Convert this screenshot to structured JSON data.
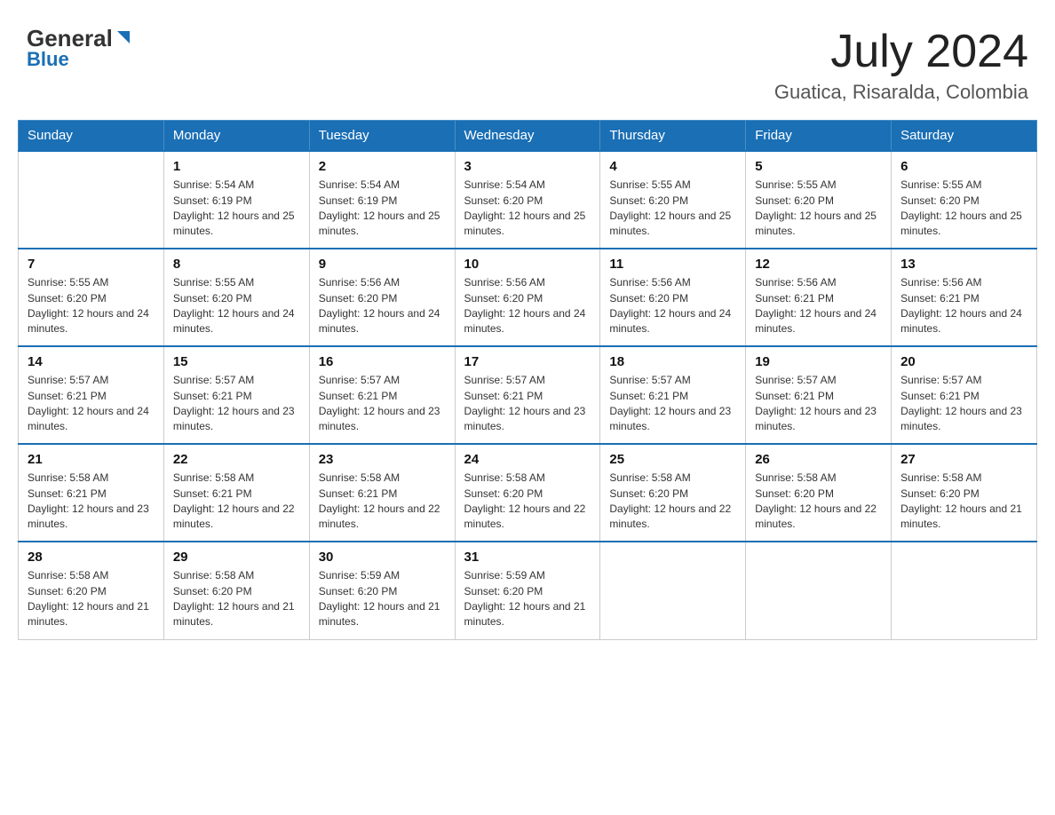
{
  "header": {
    "logo_general": "General",
    "logo_blue": "Blue",
    "month_title": "July 2024",
    "location": "Guatica, Risaralda, Colombia"
  },
  "weekdays": [
    "Sunday",
    "Monday",
    "Tuesday",
    "Wednesday",
    "Thursday",
    "Friday",
    "Saturday"
  ],
  "weeks": [
    [
      {
        "day": "",
        "sunrise": "",
        "sunset": "",
        "daylight": ""
      },
      {
        "day": "1",
        "sunrise": "Sunrise: 5:54 AM",
        "sunset": "Sunset: 6:19 PM",
        "daylight": "Daylight: 12 hours and 25 minutes."
      },
      {
        "day": "2",
        "sunrise": "Sunrise: 5:54 AM",
        "sunset": "Sunset: 6:19 PM",
        "daylight": "Daylight: 12 hours and 25 minutes."
      },
      {
        "day": "3",
        "sunrise": "Sunrise: 5:54 AM",
        "sunset": "Sunset: 6:20 PM",
        "daylight": "Daylight: 12 hours and 25 minutes."
      },
      {
        "day": "4",
        "sunrise": "Sunrise: 5:55 AM",
        "sunset": "Sunset: 6:20 PM",
        "daylight": "Daylight: 12 hours and 25 minutes."
      },
      {
        "day": "5",
        "sunrise": "Sunrise: 5:55 AM",
        "sunset": "Sunset: 6:20 PM",
        "daylight": "Daylight: 12 hours and 25 minutes."
      },
      {
        "day": "6",
        "sunrise": "Sunrise: 5:55 AM",
        "sunset": "Sunset: 6:20 PM",
        "daylight": "Daylight: 12 hours and 25 minutes."
      }
    ],
    [
      {
        "day": "7",
        "sunrise": "Sunrise: 5:55 AM",
        "sunset": "Sunset: 6:20 PM",
        "daylight": "Daylight: 12 hours and 24 minutes."
      },
      {
        "day": "8",
        "sunrise": "Sunrise: 5:55 AM",
        "sunset": "Sunset: 6:20 PM",
        "daylight": "Daylight: 12 hours and 24 minutes."
      },
      {
        "day": "9",
        "sunrise": "Sunrise: 5:56 AM",
        "sunset": "Sunset: 6:20 PM",
        "daylight": "Daylight: 12 hours and 24 minutes."
      },
      {
        "day": "10",
        "sunrise": "Sunrise: 5:56 AM",
        "sunset": "Sunset: 6:20 PM",
        "daylight": "Daylight: 12 hours and 24 minutes."
      },
      {
        "day": "11",
        "sunrise": "Sunrise: 5:56 AM",
        "sunset": "Sunset: 6:20 PM",
        "daylight": "Daylight: 12 hours and 24 minutes."
      },
      {
        "day": "12",
        "sunrise": "Sunrise: 5:56 AM",
        "sunset": "Sunset: 6:21 PM",
        "daylight": "Daylight: 12 hours and 24 minutes."
      },
      {
        "day": "13",
        "sunrise": "Sunrise: 5:56 AM",
        "sunset": "Sunset: 6:21 PM",
        "daylight": "Daylight: 12 hours and 24 minutes."
      }
    ],
    [
      {
        "day": "14",
        "sunrise": "Sunrise: 5:57 AM",
        "sunset": "Sunset: 6:21 PM",
        "daylight": "Daylight: 12 hours and 24 minutes."
      },
      {
        "day": "15",
        "sunrise": "Sunrise: 5:57 AM",
        "sunset": "Sunset: 6:21 PM",
        "daylight": "Daylight: 12 hours and 23 minutes."
      },
      {
        "day": "16",
        "sunrise": "Sunrise: 5:57 AM",
        "sunset": "Sunset: 6:21 PM",
        "daylight": "Daylight: 12 hours and 23 minutes."
      },
      {
        "day": "17",
        "sunrise": "Sunrise: 5:57 AM",
        "sunset": "Sunset: 6:21 PM",
        "daylight": "Daylight: 12 hours and 23 minutes."
      },
      {
        "day": "18",
        "sunrise": "Sunrise: 5:57 AM",
        "sunset": "Sunset: 6:21 PM",
        "daylight": "Daylight: 12 hours and 23 minutes."
      },
      {
        "day": "19",
        "sunrise": "Sunrise: 5:57 AM",
        "sunset": "Sunset: 6:21 PM",
        "daylight": "Daylight: 12 hours and 23 minutes."
      },
      {
        "day": "20",
        "sunrise": "Sunrise: 5:57 AM",
        "sunset": "Sunset: 6:21 PM",
        "daylight": "Daylight: 12 hours and 23 minutes."
      }
    ],
    [
      {
        "day": "21",
        "sunrise": "Sunrise: 5:58 AM",
        "sunset": "Sunset: 6:21 PM",
        "daylight": "Daylight: 12 hours and 23 minutes."
      },
      {
        "day": "22",
        "sunrise": "Sunrise: 5:58 AM",
        "sunset": "Sunset: 6:21 PM",
        "daylight": "Daylight: 12 hours and 22 minutes."
      },
      {
        "day": "23",
        "sunrise": "Sunrise: 5:58 AM",
        "sunset": "Sunset: 6:21 PM",
        "daylight": "Daylight: 12 hours and 22 minutes."
      },
      {
        "day": "24",
        "sunrise": "Sunrise: 5:58 AM",
        "sunset": "Sunset: 6:20 PM",
        "daylight": "Daylight: 12 hours and 22 minutes."
      },
      {
        "day": "25",
        "sunrise": "Sunrise: 5:58 AM",
        "sunset": "Sunset: 6:20 PM",
        "daylight": "Daylight: 12 hours and 22 minutes."
      },
      {
        "day": "26",
        "sunrise": "Sunrise: 5:58 AM",
        "sunset": "Sunset: 6:20 PM",
        "daylight": "Daylight: 12 hours and 22 minutes."
      },
      {
        "day": "27",
        "sunrise": "Sunrise: 5:58 AM",
        "sunset": "Sunset: 6:20 PM",
        "daylight": "Daylight: 12 hours and 21 minutes."
      }
    ],
    [
      {
        "day": "28",
        "sunrise": "Sunrise: 5:58 AM",
        "sunset": "Sunset: 6:20 PM",
        "daylight": "Daylight: 12 hours and 21 minutes."
      },
      {
        "day": "29",
        "sunrise": "Sunrise: 5:58 AM",
        "sunset": "Sunset: 6:20 PM",
        "daylight": "Daylight: 12 hours and 21 minutes."
      },
      {
        "day": "30",
        "sunrise": "Sunrise: 5:59 AM",
        "sunset": "Sunset: 6:20 PM",
        "daylight": "Daylight: 12 hours and 21 minutes."
      },
      {
        "day": "31",
        "sunrise": "Sunrise: 5:59 AM",
        "sunset": "Sunset: 6:20 PM",
        "daylight": "Daylight: 12 hours and 21 minutes."
      },
      {
        "day": "",
        "sunrise": "",
        "sunset": "",
        "daylight": ""
      },
      {
        "day": "",
        "sunrise": "",
        "sunset": "",
        "daylight": ""
      },
      {
        "day": "",
        "sunrise": "",
        "sunset": "",
        "daylight": ""
      }
    ]
  ]
}
